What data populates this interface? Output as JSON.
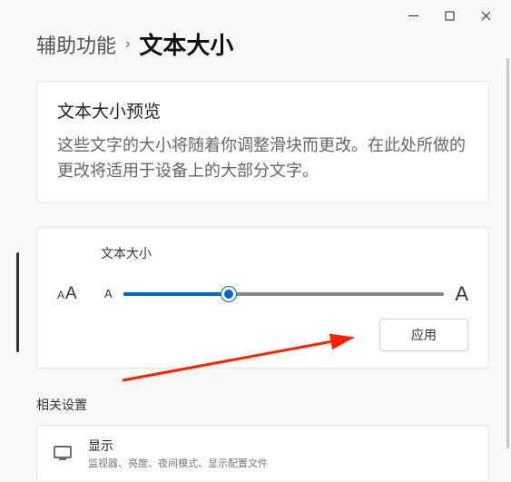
{
  "breadcrumb": {
    "parent": "辅助功能",
    "current": "文本大小"
  },
  "preview": {
    "title": "文本大小预览",
    "text": "这些文字的大小将随着你调整滑块而更改。在此处所做的更改将适用于设备上的大部分文字。"
  },
  "slider": {
    "label": "文本大小",
    "min_glyph": "A",
    "max_glyph": "A",
    "apply": "应用"
  },
  "related": {
    "title": "相关设置",
    "display": {
      "label": "显示",
      "sub": "监视器、亮度、夜间模式、显示配置文件"
    }
  }
}
